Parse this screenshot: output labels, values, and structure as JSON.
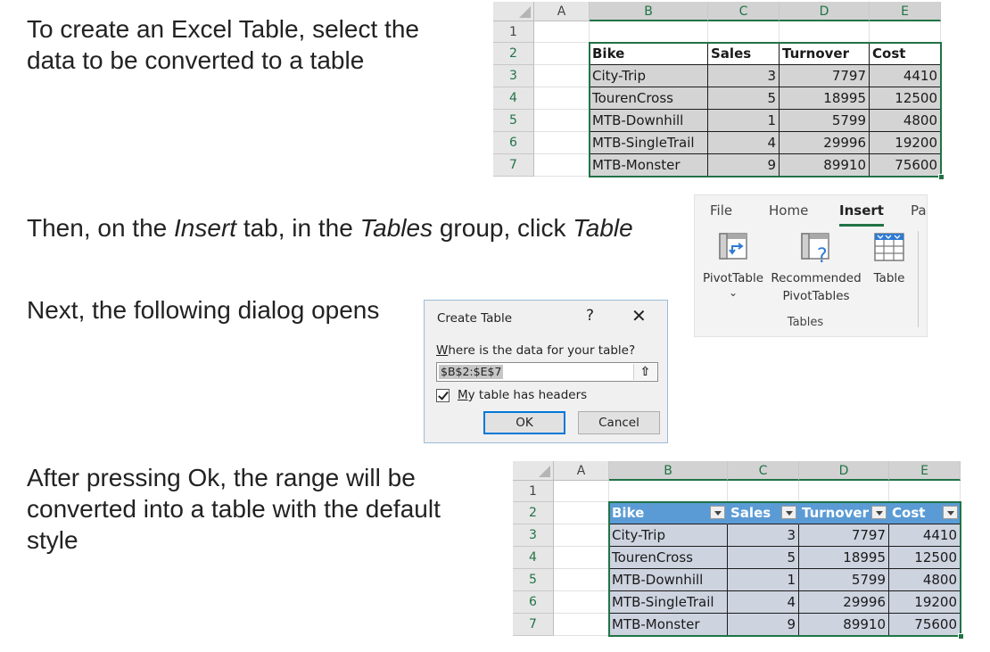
{
  "steps": {
    "s1_line1": "To create an Excel Table, select the",
    "s1_line2": "data to be converted to a table",
    "s2_a": "Then, on the ",
    "s2_b": "Insert",
    "s2_c": " tab, in the ",
    "s2_d": "Tables",
    "s2_e": " group, click ",
    "s2_f": "Table",
    "s3": "Next, the following dialog opens",
    "s4_line1": "After pressing Ok, the range will be",
    "s4_line2": "converted into a table with the default",
    "s4_line3": "style"
  },
  "sheet": {
    "columns": [
      "A",
      "B",
      "C",
      "D",
      "E"
    ],
    "rows": [
      "1",
      "2",
      "3",
      "4",
      "5",
      "6",
      "7"
    ],
    "headers": [
      "Bike",
      "Sales",
      "Turnover",
      "Cost"
    ],
    "data": [
      [
        "City-Trip",
        "3",
        "7797",
        "4410"
      ],
      [
        "TourenCross",
        "5",
        "18995",
        "12500"
      ],
      [
        "MTB-Downhill",
        "1",
        "5799",
        "4800"
      ],
      [
        "MTB-SingleTrail",
        "4",
        "29996",
        "19200"
      ],
      [
        "MTB-Monster",
        "9",
        "89910",
        "75600"
      ]
    ]
  },
  "ribbon": {
    "tabs": [
      "File",
      "Home",
      "Insert",
      "Pa"
    ],
    "active_tab": "Insert",
    "pivot_label": "PivotTable",
    "pivot_caret": "⌄",
    "recommended_line1": "Recommended",
    "recommended_line2": "PivotTables",
    "table_label": "Table",
    "group_label": "Tables"
  },
  "dialog": {
    "title": "Create Table",
    "help": "?",
    "close": "✕",
    "question_first": "W",
    "question_rest": "here is the data for your table?",
    "range_value": "$B$2:$E$7",
    "collapse_icon": "⇧",
    "checkbox_checked": true,
    "checkbox_first": "M",
    "checkbox_rest": "y table has headers",
    "ok_label": "OK",
    "cancel_label": "Cancel"
  },
  "colors": {
    "excel_green": "#217346",
    "table_header_blue": "#5b9bd5",
    "table_row_fill": "#cdd3df",
    "selection_fill": "#d4d4d4"
  }
}
